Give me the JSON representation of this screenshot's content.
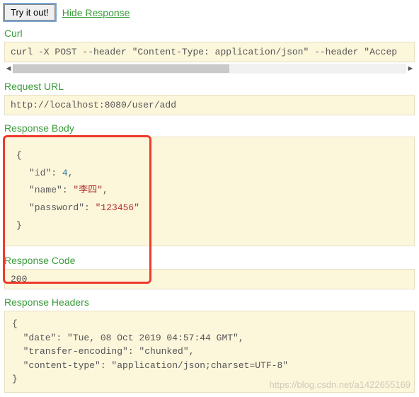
{
  "actions": {
    "try_label": "Try it out!",
    "hide_label": "Hide Response"
  },
  "sections": {
    "curl": "Curl",
    "request_url": "Request URL",
    "response_body": "Response Body",
    "response_code": "Response Code",
    "response_headers": "Response Headers"
  },
  "curl_command": "curl -X POST --header \"Content-Type: application/json\" --header \"Accep",
  "request_url": "http://localhost:8080/user/add",
  "response_body": {
    "id_key": "\"id\"",
    "id_val": "4",
    "comma": ",",
    "name_key": "\"name\"",
    "name_val": "\"李四\"",
    "password_key": "\"password\"",
    "password_val": "\"123456\""
  },
  "brace_open": "{",
  "brace_close": "}",
  "colon": ": ",
  "response_code": "200",
  "response_headers_text": "{\n  \"date\": \"Tue, 08 Oct 2019 04:57:44 GMT\",\n  \"transfer-encoding\": \"chunked\",\n  \"content-type\": \"application/json;charset=UTF-8\"\n}",
  "watermark": "https://blog.csdn.net/a1422655169"
}
